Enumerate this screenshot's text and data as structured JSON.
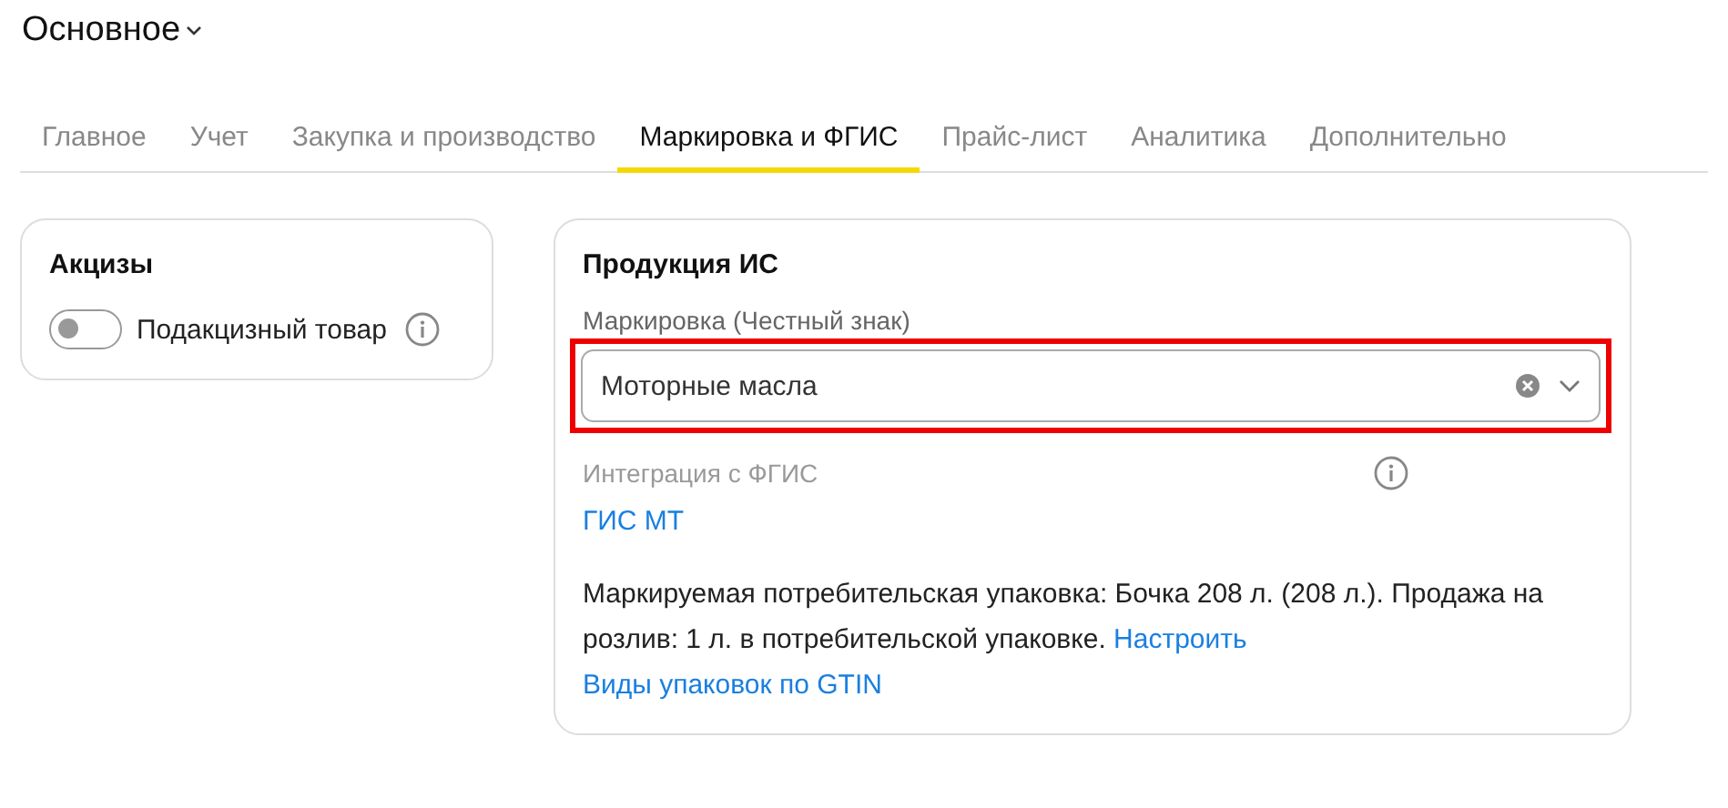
{
  "header": {
    "title": "Основное"
  },
  "tabs": [
    {
      "label": "Главное",
      "selected": false
    },
    {
      "label": "Учет",
      "selected": false
    },
    {
      "label": "Закупка и производство",
      "selected": false
    },
    {
      "label": "Маркировка и ФГИС",
      "selected": true
    },
    {
      "label": "Прайс-лист",
      "selected": false
    },
    {
      "label": "Аналитика",
      "selected": false
    },
    {
      "label": "Дополнительно",
      "selected": false
    }
  ],
  "excise_card": {
    "title": "Акцизы",
    "toggle": {
      "label": "Подакцизный товар",
      "on": false
    }
  },
  "product_card": {
    "title": "Продукция ИС",
    "marking": {
      "label": "Маркировка (Честный знак)",
      "value": "Моторные масла",
      "highlighted": true
    },
    "integration": {
      "label": "Интеграция с ФГИС",
      "link": "ГИС МТ"
    },
    "description": {
      "text": "Маркируемая потребительская упаковка: Бочка 208 л. (208 л.). Продажа на розлив: 1 л. в потребительской упаковке.",
      "link": "Настроить"
    },
    "gtin_link": "Виды упаковок по GTIN"
  }
}
